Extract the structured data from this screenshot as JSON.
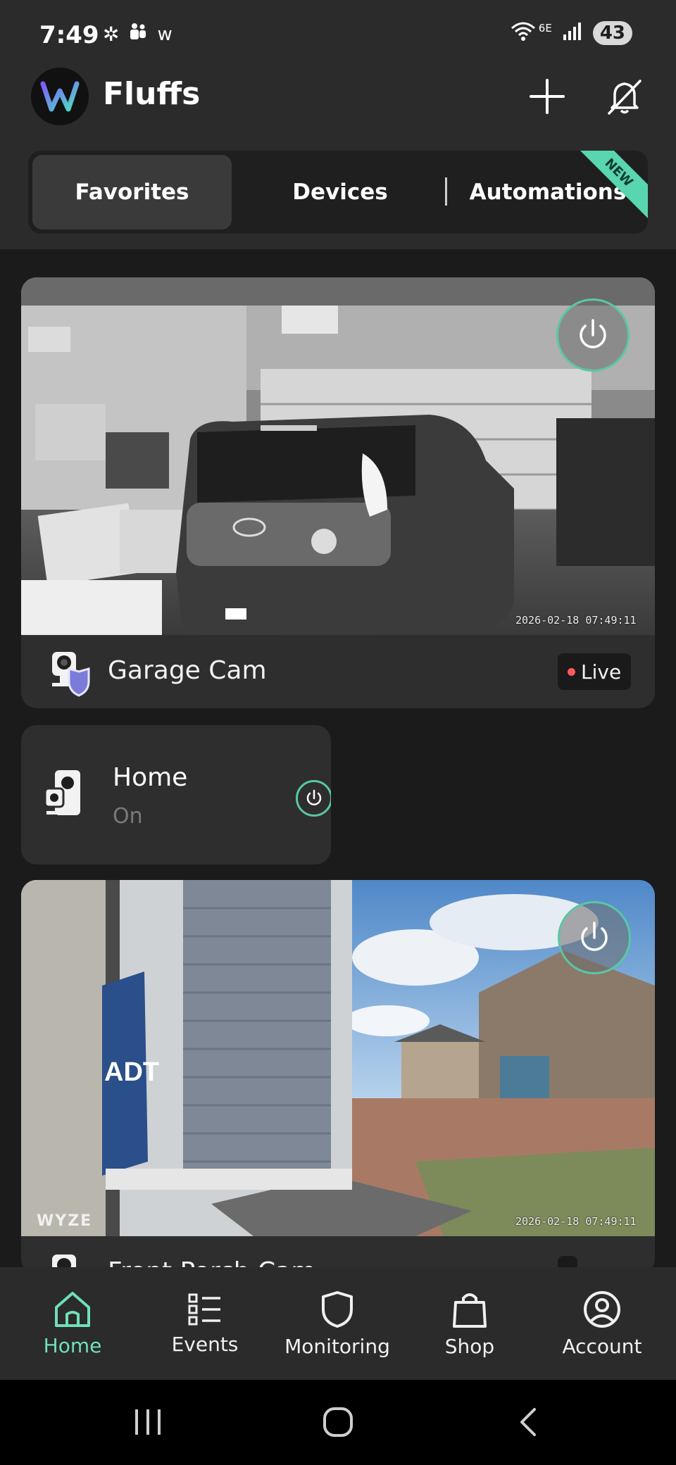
{
  "status_bar": {
    "time": "7:49",
    "left_icons": [
      "sparkle-icon",
      "teams-icon",
      "w-icon"
    ],
    "wifi_label": "6E",
    "battery": "43"
  },
  "header": {
    "app_title": "Fluffs",
    "add_icon": "plus-icon",
    "notifications_icon": "bell-off-icon"
  },
  "tabs": [
    {
      "label": "Favorites",
      "active": true
    },
    {
      "label": "Devices",
      "active": false
    },
    {
      "label": "Automations",
      "active": false,
      "badge": "NEW"
    }
  ],
  "devices": {
    "garage": {
      "name": "Garage Cam",
      "status": "Live",
      "timestamp": "2026-02-18 07:49:11"
    },
    "home": {
      "name": "Home",
      "state": "On"
    },
    "front": {
      "name": "Front Porch Cam",
      "timestamp": "2026-02-18 07:49:11",
      "watermark": "WYZE",
      "sign_text": "ADT"
    }
  },
  "bottom_nav": [
    {
      "label": "Home",
      "icon": "home-icon",
      "active": true
    },
    {
      "label": "Events",
      "icon": "events-icon",
      "active": false
    },
    {
      "label": "Monitoring",
      "icon": "shield-icon",
      "active": false
    },
    {
      "label": "Shop",
      "icon": "shopping-bag-icon",
      "active": false
    },
    {
      "label": "Account",
      "icon": "account-icon",
      "active": false
    }
  ],
  "colors": {
    "accent": "#6fe0b8",
    "background": "#1b1b1b",
    "surface": "#2e2e2e",
    "live_dot": "#ff5a5a"
  }
}
